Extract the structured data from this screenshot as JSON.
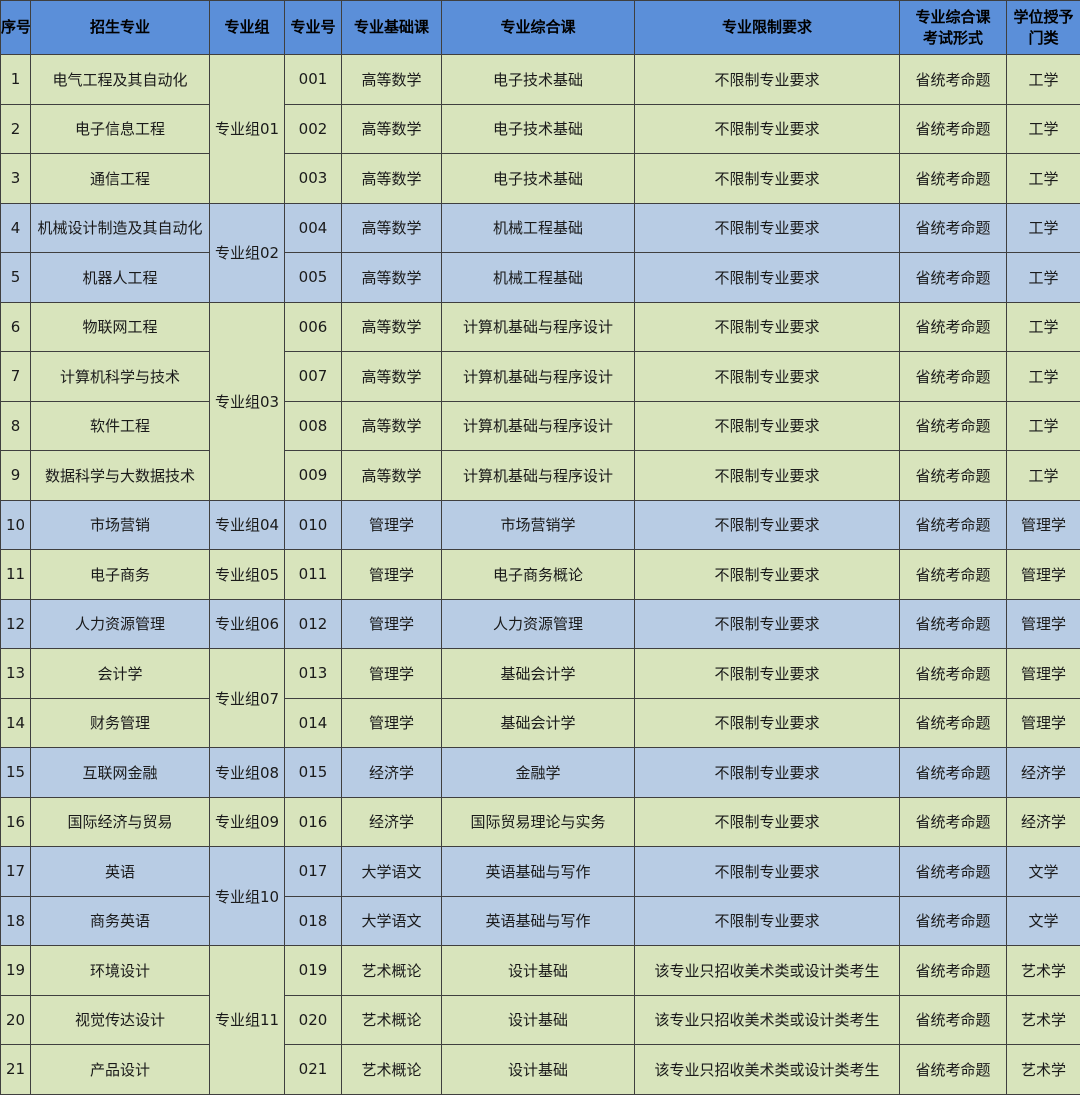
{
  "headers": [
    "序号",
    "招生专业",
    "专业组",
    "专业号",
    "专业基础课",
    "专业综合课",
    "专业限制要求",
    "专业综合课考试形式",
    "学位授予门类"
  ],
  "header_lines": {
    "exam": [
      "专业综合课",
      "考试形式"
    ],
    "degree": [
      "学位授予",
      "门类"
    ]
  },
  "colors": {
    "header": "#5b8fd9",
    "green_row": "#d8e4bc",
    "blue_row": "#b8cce4",
    "border": "#3f3f3f"
  },
  "groups": [
    {
      "name": "专业组01",
      "color": "green",
      "rows": [
        {
          "seq": "1",
          "major": "电气工程及其自动化",
          "code": "001",
          "base": "高等数学",
          "comp": "电子技术基础",
          "limit": "不限制专业要求",
          "exam": "省统考命题",
          "degree": "工学"
        },
        {
          "seq": "2",
          "major": "电子信息工程",
          "code": "002",
          "base": "高等数学",
          "comp": "电子技术基础",
          "limit": "不限制专业要求",
          "exam": "省统考命题",
          "degree": "工学"
        },
        {
          "seq": "3",
          "major": "通信工程",
          "code": "003",
          "base": "高等数学",
          "comp": "电子技术基础",
          "limit": "不限制专业要求",
          "exam": "省统考命题",
          "degree": "工学"
        }
      ]
    },
    {
      "name": "专业组02",
      "color": "blue",
      "rows": [
        {
          "seq": "4",
          "major": "机械设计制造及其自动化",
          "code": "004",
          "base": "高等数学",
          "comp": "机械工程基础",
          "limit": "不限制专业要求",
          "exam": "省统考命题",
          "degree": "工学"
        },
        {
          "seq": "5",
          "major": "机器人工程",
          "code": "005",
          "base": "高等数学",
          "comp": "机械工程基础",
          "limit": "不限制专业要求",
          "exam": "省统考命题",
          "degree": "工学"
        }
      ]
    },
    {
      "name": "专业组03",
      "color": "green",
      "rows": [
        {
          "seq": "6",
          "major": "物联网工程",
          "code": "006",
          "base": "高等数学",
          "comp": "计算机基础与程序设计",
          "limit": "不限制专业要求",
          "exam": "省统考命题",
          "degree": "工学"
        },
        {
          "seq": "7",
          "major": "计算机科学与技术",
          "code": "007",
          "base": "高等数学",
          "comp": "计算机基础与程序设计",
          "limit": "不限制专业要求",
          "exam": "省统考命题",
          "degree": "工学"
        },
        {
          "seq": "8",
          "major": "软件工程",
          "code": "008",
          "base": "高等数学",
          "comp": "计算机基础与程序设计",
          "limit": "不限制专业要求",
          "exam": "省统考命题",
          "degree": "工学"
        },
        {
          "seq": "9",
          "major": "数据科学与大数据技术",
          "code": "009",
          "base": "高等数学",
          "comp": "计算机基础与程序设计",
          "limit": "不限制专业要求",
          "exam": "省统考命题",
          "degree": "工学"
        }
      ]
    },
    {
      "name": "专业组04",
      "color": "blue",
      "rows": [
        {
          "seq": "10",
          "major": "市场营销",
          "code": "010",
          "base": "管理学",
          "comp": "市场营销学",
          "limit": "不限制专业要求",
          "exam": "省统考命题",
          "degree": "管理学"
        }
      ]
    },
    {
      "name": "专业组05",
      "color": "green",
      "rows": [
        {
          "seq": "11",
          "major": "电子商务",
          "code": "011",
          "base": "管理学",
          "comp": "电子商务概论",
          "limit": "不限制专业要求",
          "exam": "省统考命题",
          "degree": "管理学"
        }
      ]
    },
    {
      "name": "专业组06",
      "color": "blue",
      "rows": [
        {
          "seq": "12",
          "major": "人力资源管理",
          "code": "012",
          "base": "管理学",
          "comp": "人力资源管理",
          "limit": "不限制专业要求",
          "exam": "省统考命题",
          "degree": "管理学"
        }
      ]
    },
    {
      "name": "专业组07",
      "color": "green",
      "rows": [
        {
          "seq": "13",
          "major": "会计学",
          "code": "013",
          "base": "管理学",
          "comp": "基础会计学",
          "limit": "不限制专业要求",
          "exam": "省统考命题",
          "degree": "管理学"
        },
        {
          "seq": "14",
          "major": "财务管理",
          "code": "014",
          "base": "管理学",
          "comp": "基础会计学",
          "limit": "不限制专业要求",
          "exam": "省统考命题",
          "degree": "管理学"
        }
      ]
    },
    {
      "name": "专业组08",
      "color": "blue",
      "rows": [
        {
          "seq": "15",
          "major": "互联网金融",
          "code": "015",
          "base": "经济学",
          "comp": "金融学",
          "limit": "不限制专业要求",
          "exam": "省统考命题",
          "degree": "经济学"
        }
      ]
    },
    {
      "name": "专业组09",
      "color": "green",
      "rows": [
        {
          "seq": "16",
          "major": "国际经济与贸易",
          "code": "016",
          "base": "经济学",
          "comp": "国际贸易理论与实务",
          "limit": "不限制专业要求",
          "exam": "省统考命题",
          "degree": "经济学"
        }
      ]
    },
    {
      "name": "专业组10",
      "color": "blue",
      "rows": [
        {
          "seq": "17",
          "major": "英语",
          "code": "017",
          "base": "大学语文",
          "comp": "英语基础与写作",
          "limit": "不限制专业要求",
          "exam": "省统考命题",
          "degree": "文学"
        },
        {
          "seq": "18",
          "major": "商务英语",
          "code": "018",
          "base": "大学语文",
          "comp": "英语基础与写作",
          "limit": "不限制专业要求",
          "exam": "省统考命题",
          "degree": "文学"
        }
      ]
    },
    {
      "name": "专业组11",
      "color": "green",
      "rows": [
        {
          "seq": "19",
          "major": "环境设计",
          "code": "019",
          "base": "艺术概论",
          "comp": "设计基础",
          "limit": "该专业只招收美术类或设计类考生",
          "exam": "省统考命题",
          "degree": "艺术学"
        },
        {
          "seq": "20",
          "major": "视觉传达设计",
          "code": "020",
          "base": "艺术概论",
          "comp": "设计基础",
          "limit": "该专业只招收美术类或设计类考生",
          "exam": "省统考命题",
          "degree": "艺术学"
        },
        {
          "seq": "21",
          "major": "产品设计",
          "code": "021",
          "base": "艺术概论",
          "comp": "设计基础",
          "limit": "该专业只招收美术类或设计类考生",
          "exam": "省统考命题",
          "degree": "艺术学"
        }
      ]
    }
  ]
}
